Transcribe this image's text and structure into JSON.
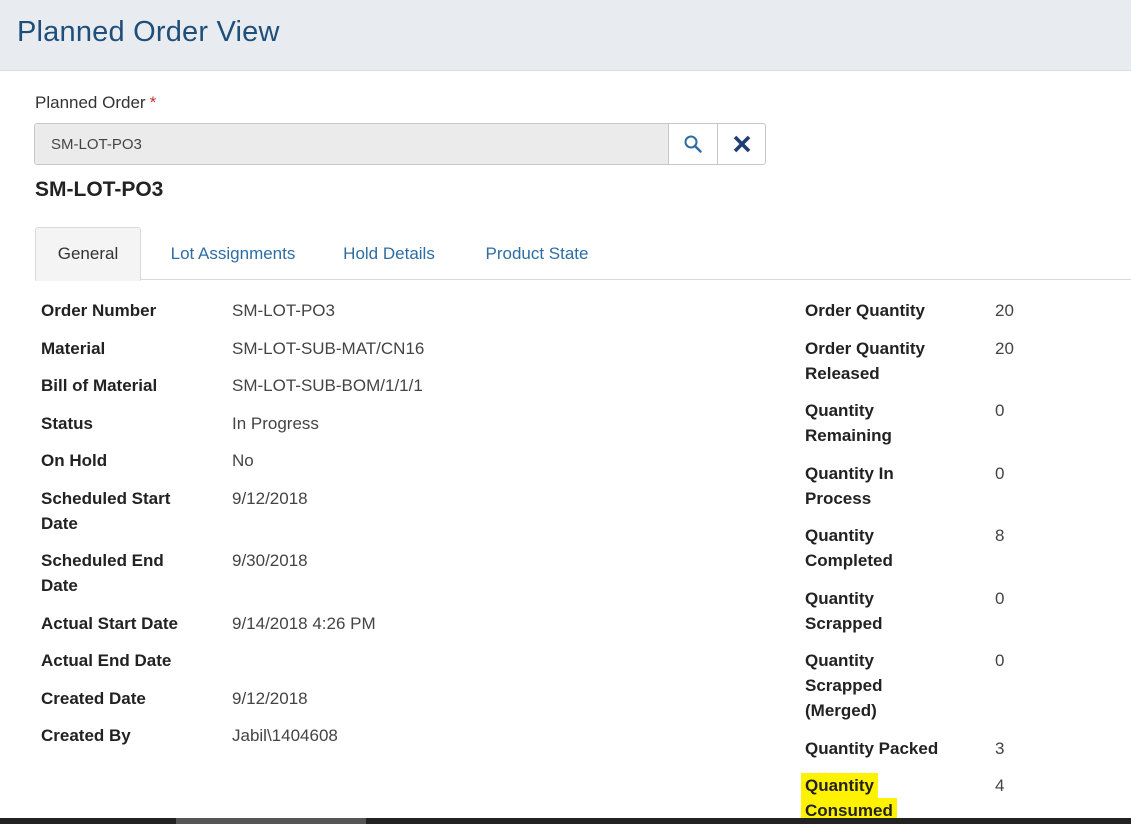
{
  "header": {
    "title": "Planned Order View"
  },
  "lookup": {
    "label": "Planned Order",
    "required_mark": "*",
    "value": "SM-LOT-PO3",
    "search_icon": "search-icon",
    "clear_icon": "close-icon"
  },
  "record_title": "SM-LOT-PO3",
  "tabs": [
    {
      "label": "General",
      "active": true
    },
    {
      "label": "Lot Assignments",
      "active": false
    },
    {
      "label": "Hold Details",
      "active": false
    },
    {
      "label": "Product State",
      "active": false
    }
  ],
  "left_fields": [
    {
      "label": "Order Number",
      "value": "SM-LOT-PO3"
    },
    {
      "label": "Material",
      "value": "SM-LOT-SUB-MAT/CN16"
    },
    {
      "label": "Bill of Material",
      "value": "SM-LOT-SUB-BOM/1/1/1"
    },
    {
      "label": "Status",
      "value": "In Progress"
    },
    {
      "label": "On Hold",
      "value": "No"
    },
    {
      "label": "Scheduled Start Date",
      "label_lines": [
        "Scheduled Start",
        "Date"
      ],
      "value": "9/12/2018"
    },
    {
      "label": "Scheduled End Date",
      "label_lines": [
        "Scheduled End",
        "Date"
      ],
      "value": "9/30/2018"
    },
    {
      "label": "Actual Start Date",
      "value": "9/14/2018 4:26 PM"
    },
    {
      "label": "Actual End Date",
      "value": ""
    },
    {
      "label": "Created Date",
      "value": "9/12/2018"
    },
    {
      "label": "Created By",
      "value": "Jabil\\1404608"
    }
  ],
  "right_fields": [
    {
      "label": "Order Quantity",
      "value": "20"
    },
    {
      "label": "Order Quantity Released",
      "label_lines": [
        "Order Quantity",
        "Released"
      ],
      "value": "20"
    },
    {
      "label": "Quantity Remaining",
      "label_lines": [
        "Quantity",
        "Remaining"
      ],
      "value": "0"
    },
    {
      "label": "Quantity In Process",
      "label_lines": [
        "Quantity In",
        "Process"
      ],
      "value": "0"
    },
    {
      "label": "Quantity Completed",
      "label_lines": [
        "Quantity",
        "Completed"
      ],
      "value": "8"
    },
    {
      "label": "Quantity Scrapped",
      "label_lines": [
        "Quantity",
        "Scrapped"
      ],
      "value": "0"
    },
    {
      "label": "Quantity Scrapped (Merged)",
      "label_lines": [
        "Quantity",
        "Scrapped",
        "(Merged)"
      ],
      "value": "0"
    },
    {
      "label": "Quantity Packed",
      "value": "3"
    },
    {
      "label": "Quantity Consumed",
      "label_lines": [
        "Quantity",
        "Consumed"
      ],
      "value": "4",
      "highlighted": true
    }
  ],
  "colors": {
    "header_bg": "#e8ecf1",
    "title_blue": "#1f4e79",
    "link_blue": "#2e6da4",
    "required_red": "#c9302c",
    "highlight": "#fff200"
  }
}
